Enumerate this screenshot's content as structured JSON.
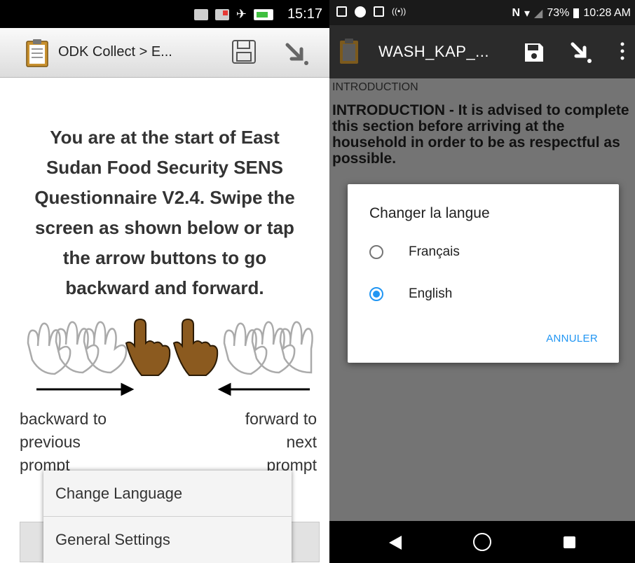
{
  "left": {
    "status": {
      "time": "15:17"
    },
    "toolbar": {
      "title": "ODK Collect > E...",
      "save_icon": "save-icon",
      "nav_icon": "jump-icon"
    },
    "main_text": "You are at the start of East\nSudan Food Security SENS\nQuestionnaire V2.4. Swipe the\nscreen as shown below or tap\nthe arrow buttons to go\nbackward and forward.",
    "backward_label": "backward to\nprevious\nprompt",
    "forward_label": "forward to\nnext\nprompt",
    "menu": {
      "items": [
        "Change Language",
        "General Settings"
      ]
    }
  },
  "right": {
    "status": {
      "battery": "73%",
      "time": "10:28 AM"
    },
    "toolbar": {
      "title": "WASH_KAP_...",
      "save_icon": "save-icon",
      "nav_icon": "jump-icon",
      "more_icon": "more-vert-icon"
    },
    "section_label": "INTRODUCTION",
    "intro_text": "INTRODUCTION - It is advised to complete this section before arriving at the household in order to be as respectful as possible.",
    "dialog": {
      "title": "Changer la langue",
      "options": [
        {
          "label": "Français",
          "selected": false
        },
        {
          "label": "English",
          "selected": true
        }
      ],
      "cancel": "ANNULER",
      "accent": "#2196f3"
    }
  }
}
